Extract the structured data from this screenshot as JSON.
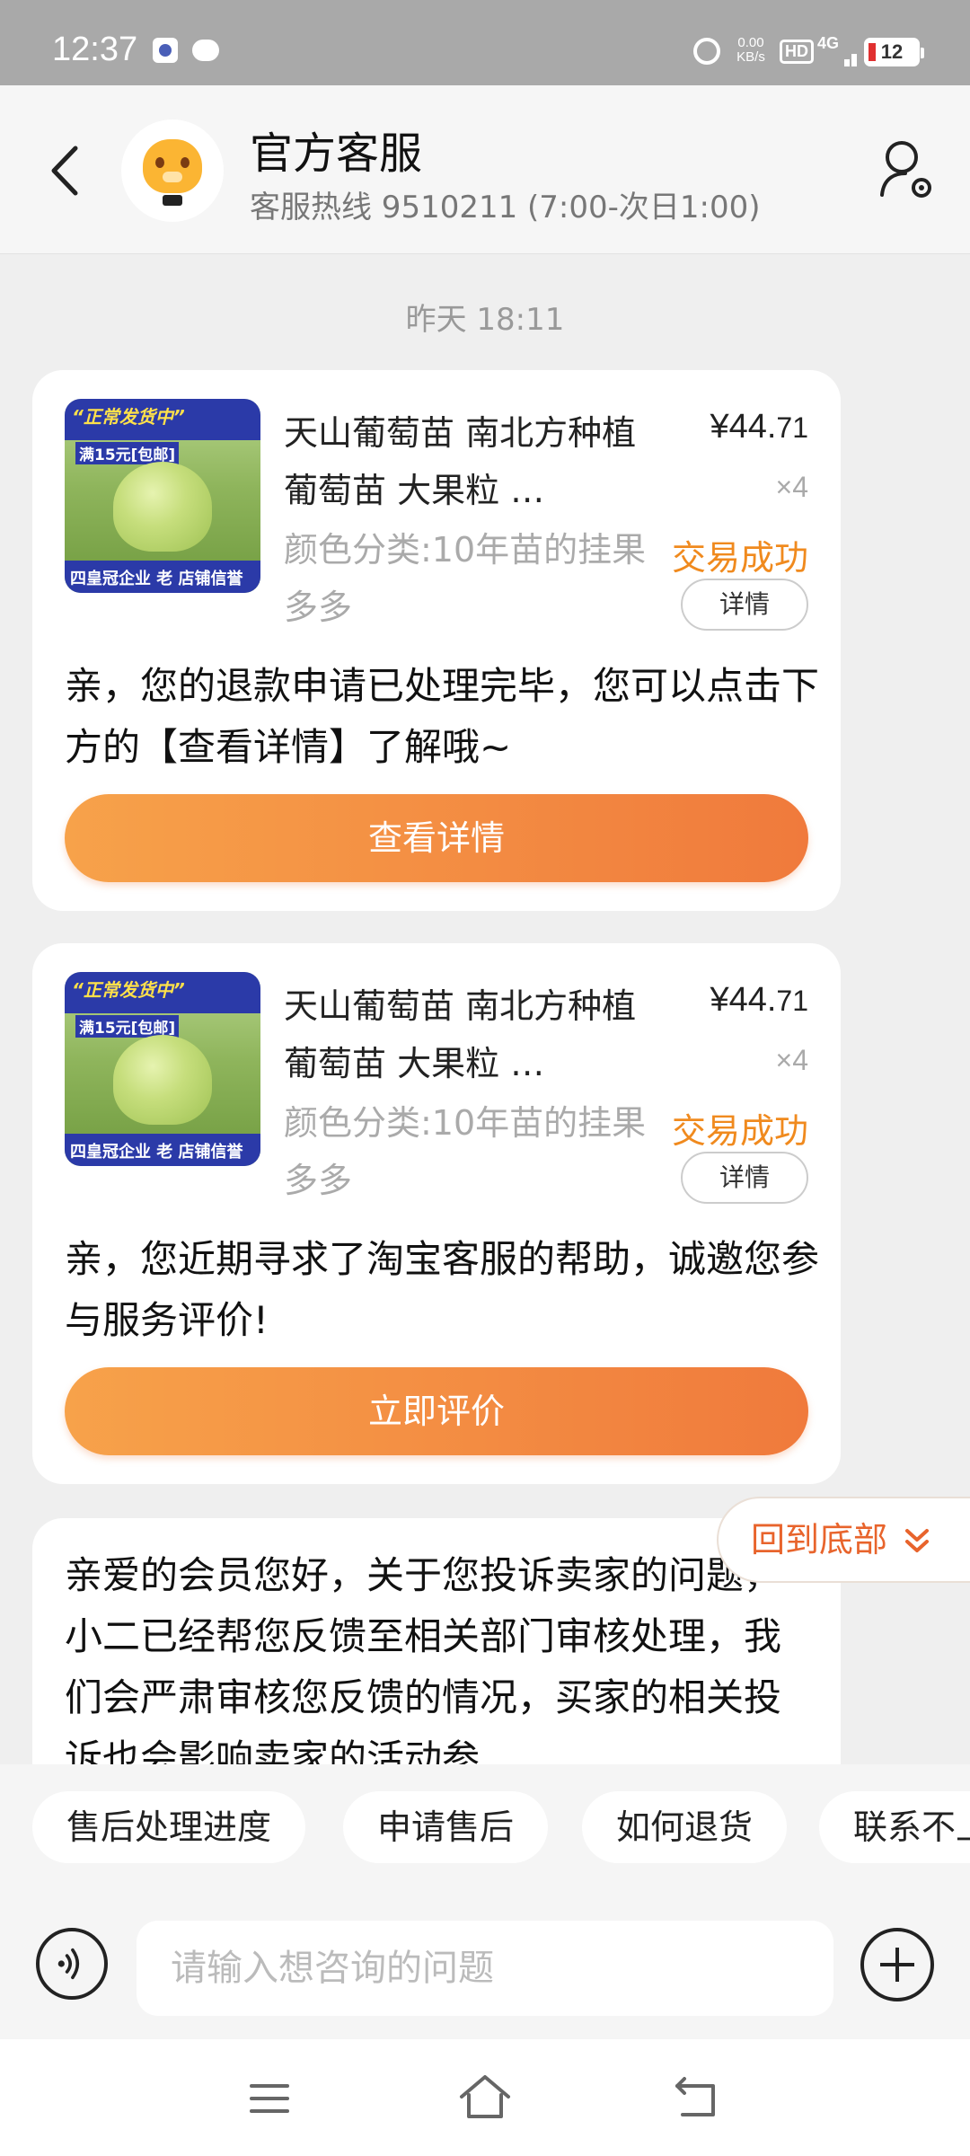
{
  "status_bar": {
    "time": "12:37",
    "net_speed_value": "0.00",
    "net_speed_unit": "KB/s",
    "hd_label": "HD",
    "network": "4G",
    "battery": "12"
  },
  "header": {
    "title": "官方客服",
    "subtitle": "客服热线 9510211 (7:00-次日1:00)"
  },
  "chat": {
    "timestamp": "昨天 18:11",
    "cards": [
      {
        "product": {
          "thumb_top": "“正常发货中”",
          "thumb_tag": "满15元[包邮]",
          "thumb_bottom": "四皇冠企业 老 店铺信誉",
          "name": "天山葡萄苗 南北方种植葡萄苗 大果粒 …",
          "spec": "颜色分类:10年苗的挂果多多",
          "price_main": "¥44.",
          "price_dec": "71",
          "qty": "×4",
          "status": "交易成功",
          "detail_label": "详情"
        },
        "message": "亲，您的退款申请已处理完毕，您可以点击下方的【查看详情】了解哦~",
        "button": "查看详情"
      },
      {
        "product": {
          "thumb_top": "“正常发货中”",
          "thumb_tag": "满15元[包邮]",
          "thumb_bottom": "四皇冠企业 老 店铺信誉",
          "name": "天山葡萄苗 南北方种植葡萄苗 大果粒 …",
          "spec": "颜色分类:10年苗的挂果多多",
          "price_main": "¥44.",
          "price_dec": "71",
          "qty": "×4",
          "status": "交易成功",
          "detail_label": "详情"
        },
        "message": "亲，您近期寻求了淘宝客服的帮助，诚邀您参与服务评价!",
        "button": "立即评价"
      },
      {
        "message": "亲爱的会员您好，关于您投诉卖家的问题，小二已经帮您反馈至相关部门审核处理，我们会严肃审核您反馈的情况，买家的相关投诉也会影响卖家的活动参"
      }
    ],
    "back_to_bottom": "回到底部"
  },
  "quick_replies": [
    "售后处理进度",
    "申请售后",
    "如何退货",
    "联系不上卖家"
  ],
  "input": {
    "placeholder": "请输入想咨询的问题",
    "value": ""
  },
  "icons": {
    "back": "back-arrow-icon",
    "user_settings": "user-settings-icon",
    "voice": "voice-icon",
    "plus": "plus-icon",
    "chevron": "double-chevron-down-icon",
    "nav_menu": "menu-icon",
    "nav_home": "home-icon",
    "nav_back": "back-icon"
  },
  "colors": {
    "accent_orange": "#f08a1e",
    "cta_gradient_start": "#f7a24a",
    "cta_gradient_end": "#f07a3c",
    "back_to_bottom_text": "#e8642c"
  }
}
